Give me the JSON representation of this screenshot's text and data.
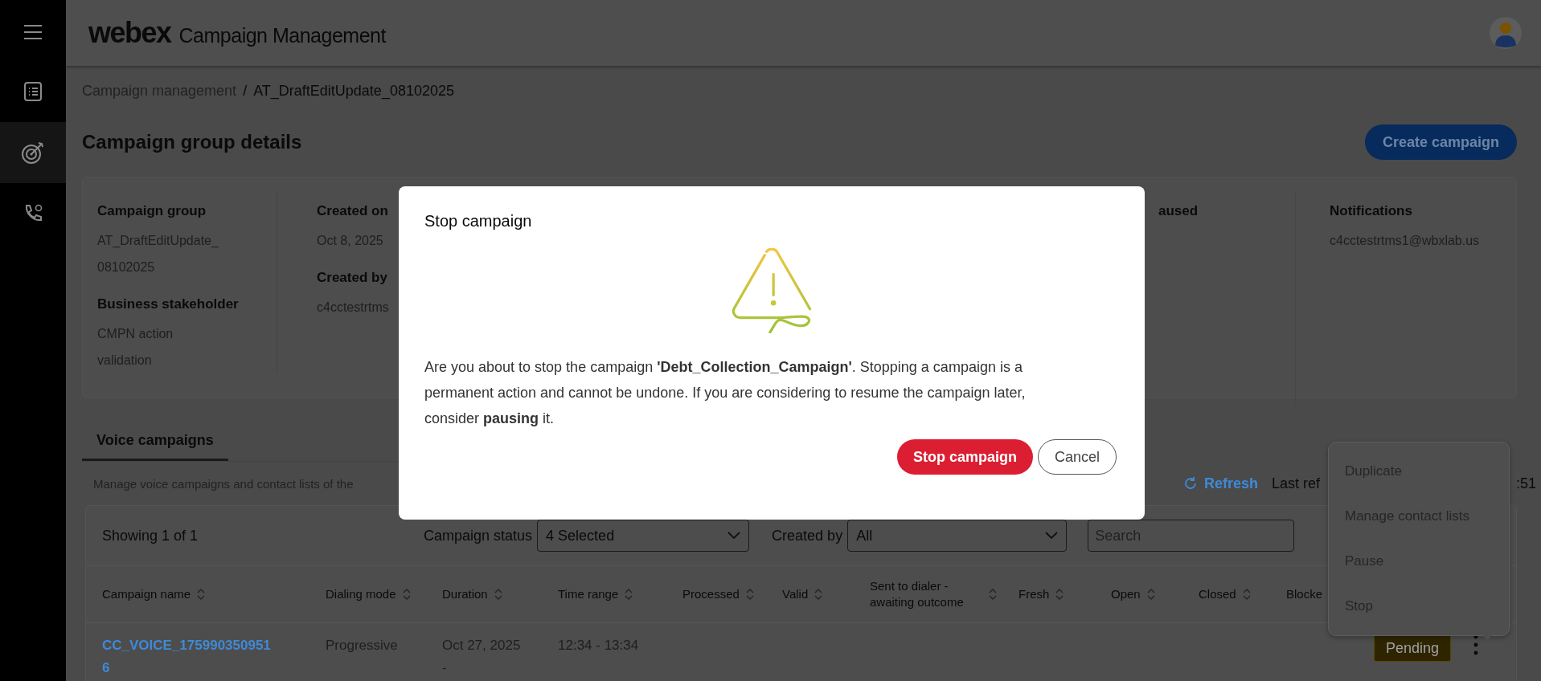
{
  "header": {
    "brand": "webex",
    "title": "Campaign Management"
  },
  "sidebar": {
    "items": [
      {
        "kind": "list",
        "selected": false
      },
      {
        "kind": "target",
        "selected": true
      },
      {
        "kind": "phone",
        "selected": false
      }
    ]
  },
  "breadcrumb": {
    "items": [
      "Campaign management",
      "AT_DraftEditUpdate_08102025"
    ],
    "separator": "/"
  },
  "page_title": "Campaign group details",
  "create_button": "Create campaign",
  "details": [
    {
      "fields": [
        {
          "label": "Campaign group",
          "value": "AT_DraftEditUpdate_08102025"
        },
        {
          "label": "Business stakeholder",
          "value": "CMPN action validation"
        }
      ]
    },
    {
      "fields": [
        {
          "label": "Created on",
          "value": "Oct 8, 2025"
        },
        {
          "label": "Created by",
          "value": "c4cctestrtms"
        }
      ]
    },
    {
      "fields": [
        {
          "label": "aused"
        }
      ]
    },
    {
      "fields": [
        {
          "label": "Notifications",
          "value": "c4cctestrtms1@wbxlab.us"
        }
      ]
    }
  ],
  "tabs": [
    {
      "label": "Voice campaigns",
      "selected": true
    }
  ],
  "description": "Manage voice campaigns and contact lists of the",
  "refresh": "Refresh",
  "last_refreshed": "Last ref",
  "last_refreshed_tail": ":51",
  "table": {
    "showing": "Showing 1 of 1",
    "filters": [
      {
        "kind": "select",
        "label": "Campaign status",
        "value": "4 Selected"
      },
      {
        "kind": "select",
        "label": "Created by",
        "value": "All"
      },
      {
        "kind": "search",
        "placeholder": "Search"
      }
    ],
    "columns": [
      "Campaign name",
      "Dialing mode",
      "Duration",
      "Time range",
      "Processed",
      "Valid",
      "Sent to dialer - awaiting outcome",
      "Fresh",
      "Open",
      "Closed",
      "Blocke"
    ],
    "rows": [
      {
        "cells": [
          "CC_VOICE_1759903509516",
          "Progressive",
          "Oct 27, 2025 -",
          "12:34 - 13:34"
        ],
        "status": "Pending"
      }
    ]
  },
  "menu": {
    "items": [
      "Duplicate",
      "Manage contact lists",
      "Pause",
      "Stop"
    ]
  },
  "modal": {
    "title": "Stop campaign",
    "body": "Are you about to stop the campaign **'Debt_Collection_Campaign'**. Stopping a campaign is a permanent action and cannot be undone. If you are considering to resume the campaign later, consider **pausing** it.",
    "buttons": [
      {
        "kind": "danger",
        "label": "Stop campaign"
      },
      {
        "kind": "secondary",
        "label": "Cancel"
      }
    ]
  }
}
